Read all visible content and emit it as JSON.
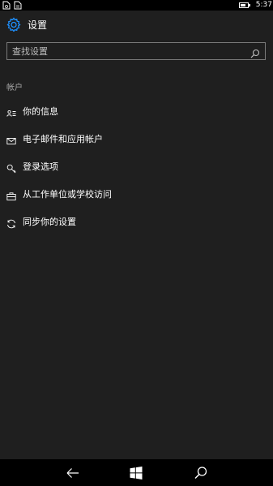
{
  "status_bar": {
    "time": "5:37",
    "battery_level": 0.75
  },
  "header": {
    "title": "设置"
  },
  "search": {
    "placeholder": "查找设置",
    "value": ""
  },
  "section": {
    "label": "帐户"
  },
  "menu": {
    "items": [
      {
        "label": "你的信息",
        "icon": "person-card-icon"
      },
      {
        "label": "电子邮件和应用帐户",
        "icon": "mail-icon"
      },
      {
        "label": "登录选项",
        "icon": "key-icon"
      },
      {
        "label": "从工作单位或学校访问",
        "icon": "briefcase-icon"
      },
      {
        "label": "同步你的设置",
        "icon": "sync-icon"
      }
    ]
  },
  "colors": {
    "background": "#1f1f1f",
    "accent": "#1e90ff",
    "status_bar": "#000000",
    "secondary_text": "#a8a8a8"
  }
}
